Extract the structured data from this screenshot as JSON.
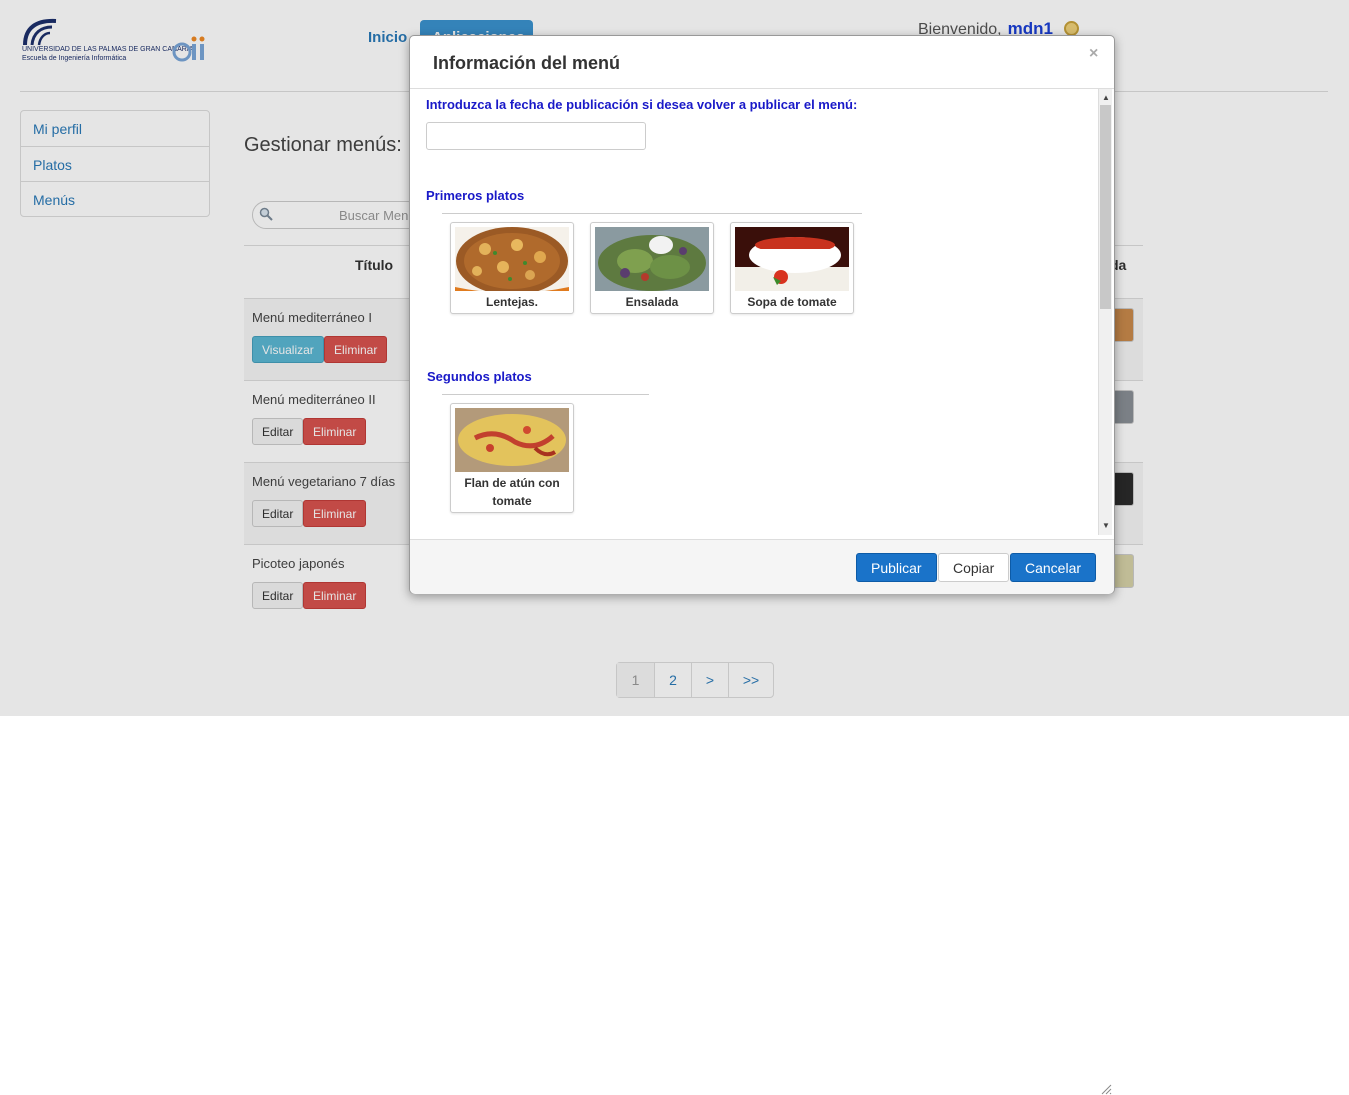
{
  "header": {
    "logo_line1": "UNIVERSIDAD DE LAS PALMAS DE GRAN CANARIA",
    "logo_line2": "Escuela de Ingeniería Informática",
    "nav_inicio": "Inicio",
    "nav_apps": "Aplicaciones",
    "welcome": "Bienvenido,",
    "username": "mdn1"
  },
  "sidebar": {
    "items": [
      {
        "label": "Mi perfil"
      },
      {
        "label": "Platos"
      },
      {
        "label": "Menús"
      }
    ]
  },
  "main": {
    "title": "Gestionar menús:",
    "search_placeholder": "Buscar Menú",
    "col_title": "Título",
    "col_right": "da",
    "rows": [
      {
        "name": "Menú mediterráneo I",
        "btn1": "Visualizar",
        "btn2": "Eliminar"
      },
      {
        "name": "Menú mediterráneo II",
        "btn1": "Editar",
        "btn2": "Eliminar"
      },
      {
        "name": "Menú vegetariano 7 días",
        "btn1": "Editar",
        "btn2": "Eliminar"
      },
      {
        "name": "Picoteo japonés",
        "btn1": "Editar",
        "btn2": "Eliminar"
      }
    ]
  },
  "pager": {
    "pages": [
      "1",
      "2",
      ">",
      ">>"
    ]
  },
  "modal": {
    "title": "Información del menú",
    "close": "×",
    "prompt": "Introduzca la fecha de publicación si desea volver a publicar el menú:",
    "date_value": "",
    "section1": "Primeros platos",
    "section2": "Segundos platos",
    "dishes1": [
      "Lentejas.",
      "Ensalada",
      "Sopa de tomate"
    ],
    "dishes2": [
      "Flan de atún con tomate"
    ],
    "buttons": {
      "publish": "Publicar",
      "copy": "Copiar",
      "cancel": "Cancelar"
    }
  },
  "colors": {
    "accent": "#1a73c9",
    "link": "#2a7ab8",
    "section": "#1919c8",
    "danger": "#d9534f",
    "info": "#5bb7d3"
  }
}
